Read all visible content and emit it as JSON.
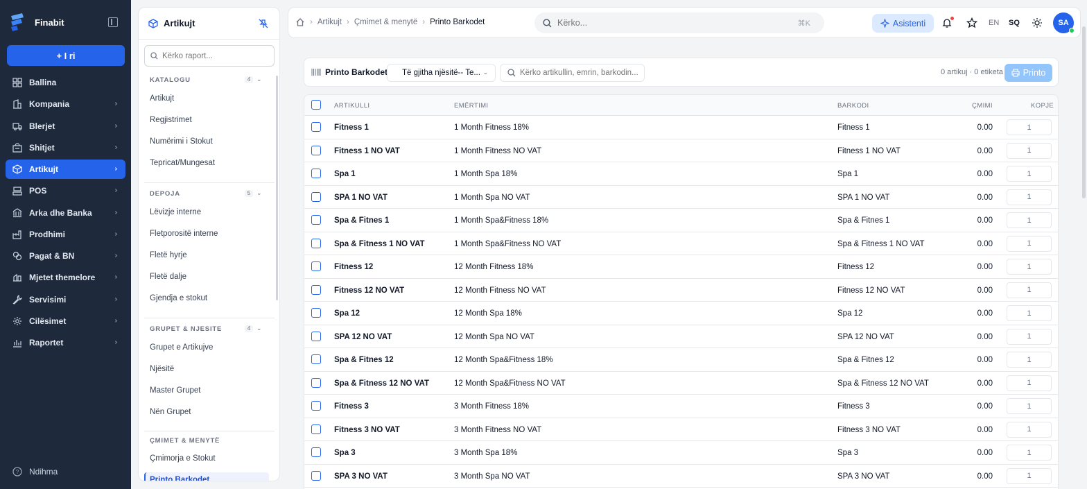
{
  "brand": {
    "name": "Finabit",
    "accent": "#2563eb"
  },
  "nav": {
    "new_button": "+ I ri",
    "items": [
      {
        "label": "Ballina",
        "icon": "dashboard-icon",
        "active": false,
        "chevron": false
      },
      {
        "label": "Kompania",
        "icon": "building-icon",
        "active": false,
        "chevron": true
      },
      {
        "label": "Blerjet",
        "icon": "truck-icon",
        "active": false,
        "chevron": true
      },
      {
        "label": "Shitjet",
        "icon": "shop-icon",
        "active": false,
        "chevron": true
      },
      {
        "label": "Artikujt",
        "icon": "box-icon",
        "active": true,
        "chevron": true
      },
      {
        "label": "POS",
        "icon": "pos-icon",
        "active": false,
        "chevron": true
      },
      {
        "label": "Arka dhe Banka",
        "icon": "bank-icon",
        "active": false,
        "chevron": true
      },
      {
        "label": "Prodhimi",
        "icon": "factory-icon",
        "active": false,
        "chevron": true
      },
      {
        "label": "Pagat & BN",
        "icon": "coins-icon",
        "active": false,
        "chevron": true
      },
      {
        "label": "Mjetet themelore",
        "icon": "assets-icon",
        "active": false,
        "chevron": true
      },
      {
        "label": "Servisimi",
        "icon": "wrench-icon",
        "active": false,
        "chevron": true
      },
      {
        "label": "Cilësimet",
        "icon": "gear-icon",
        "active": false,
        "chevron": true
      },
      {
        "label": "Raportet",
        "icon": "chart-icon",
        "active": false,
        "chevron": true
      }
    ],
    "help": "Ndihma"
  },
  "subpanel": {
    "title": "Artikujt",
    "search_placeholder": "Kërko raport...",
    "sections": [
      {
        "label": "KATALOGU",
        "count": "4",
        "items": [
          "Artikujt",
          "Regjistrimet",
          "Numërimi i Stokut",
          "Tepricat/Mungesat"
        ]
      },
      {
        "label": "DEPOJA",
        "count": "5",
        "items": [
          "Lëvizje interne",
          "Fletporositë interne",
          "Fletë hyrje",
          "Fletë dalje",
          "Gjendja e stokut"
        ]
      },
      {
        "label": "GRUPET & NJESITE",
        "count": "4",
        "items": [
          "Grupet e Artikujve",
          "Njësitë",
          "Master Grupet",
          "Nën Grupet"
        ]
      },
      {
        "label": "ÇMIMET & MENYTË",
        "count": "",
        "items": [
          "Çmimorja e Stokut",
          "Printo Barkodet"
        ]
      }
    ]
  },
  "topbar": {
    "breadcrumbs": [
      "Artikujt",
      "Çmimet & menytë",
      "Printo Barkodet"
    ],
    "search_placeholder": "Kërko...",
    "shortcut": "⌘K",
    "assistant": "Asistenti",
    "lang_en": "EN",
    "lang_sq": "SQ",
    "avatar": "SA"
  },
  "toolbar": {
    "title": "Printo Barkodet",
    "unit_select": "Të gjitha njësitë-- Te...",
    "search_placeholder": "Kërko artikullin, emrin, barkodin...",
    "counts": "0 artikuj · 0 etiketa",
    "print": "Printo"
  },
  "table": {
    "headers": {
      "item": "ARTIKULLI",
      "name": "EMËRTIMI",
      "barcode": "BARKODI",
      "price": "ÇMIMI",
      "copies": "KOPJE"
    },
    "rows": [
      {
        "item": "Fitness 1",
        "name": "1 Month Fitness 18%",
        "barcode": "Fitness 1",
        "price": "0.00",
        "copies": "1"
      },
      {
        "item": "Fitness 1 NO VAT",
        "name": "1 Month Fitness NO VAT",
        "barcode": "Fitness 1 NO VAT",
        "price": "0.00",
        "copies": "1"
      },
      {
        "item": "Spa 1",
        "name": "1 Month Spa 18%",
        "barcode": "Spa 1",
        "price": "0.00",
        "copies": "1"
      },
      {
        "item": "SPA 1 NO VAT",
        "name": "1 Month Spa NO VAT",
        "barcode": "SPA 1 NO VAT",
        "price": "0.00",
        "copies": "1"
      },
      {
        "item": "Spa & Fitnes 1",
        "name": "1 Month Spa&Fitness 18%",
        "barcode": "Spa & Fitnes 1",
        "price": "0.00",
        "copies": "1"
      },
      {
        "item": "Spa & Fitness 1 NO VAT",
        "name": "1 Month Spa&Fitness NO VAT",
        "barcode": "Spa & Fitness 1 NO VAT",
        "price": "0.00",
        "copies": "1"
      },
      {
        "item": "Fitness 12",
        "name": "12 Month Fitness 18%",
        "barcode": "Fitness 12",
        "price": "0.00",
        "copies": "1"
      },
      {
        "item": "Fitness 12 NO VAT",
        "name": "12 Month Fitness NO VAT",
        "barcode": "Fitness 12 NO VAT",
        "price": "0.00",
        "copies": "1"
      },
      {
        "item": "Spa 12",
        "name": "12 Month Spa 18%",
        "barcode": "Spa 12",
        "price": "0.00",
        "copies": "1"
      },
      {
        "item": "SPA 12 NO VAT",
        "name": "12 Month Spa NO VAT",
        "barcode": "SPA 12 NO VAT",
        "price": "0.00",
        "copies": "1"
      },
      {
        "item": "Spa & Fitnes 12",
        "name": "12 Month Spa&Fitness 18%",
        "barcode": "Spa & Fitnes 12",
        "price": "0.00",
        "copies": "1"
      },
      {
        "item": "Spa & Fitness 12 NO VAT",
        "name": "12 Month Spa&Fitness NO VAT",
        "barcode": "Spa & Fitness 12 NO VAT",
        "price": "0.00",
        "copies": "1"
      },
      {
        "item": "Fitness 3",
        "name": "3 Month Fitness 18%",
        "barcode": "Fitness 3",
        "price": "0.00",
        "copies": "1"
      },
      {
        "item": "Fitness 3 NO VAT",
        "name": "3 Month Fitness NO VAT",
        "barcode": "Fitness 3 NO VAT",
        "price": "0.00",
        "copies": "1"
      },
      {
        "item": "Spa 3",
        "name": "3 Month Spa 18%",
        "barcode": "Spa 3",
        "price": "0.00",
        "copies": "1"
      },
      {
        "item": "SPA 3 NO VAT",
        "name": "3 Month Spa NO VAT",
        "barcode": "SPA 3 NO VAT",
        "price": "0.00",
        "copies": "1"
      }
    ]
  }
}
